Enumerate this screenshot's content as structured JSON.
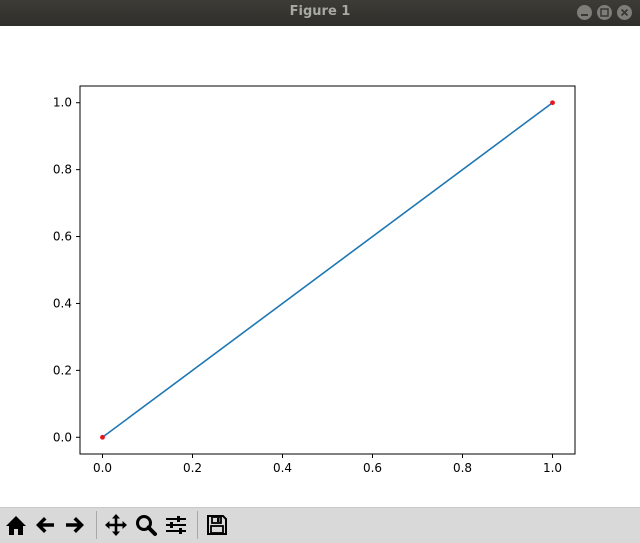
{
  "window": {
    "title": "Figure 1",
    "controls": [
      "minimize",
      "maximize",
      "close"
    ]
  },
  "chart_data": {
    "type": "line",
    "title": "",
    "xlabel": "",
    "ylabel": "",
    "xlim": [
      -0.05,
      1.05
    ],
    "ylim": [
      -0.05,
      1.05
    ],
    "x_ticks": [
      "0.0",
      "0.2",
      "0.4",
      "0.6",
      "0.8",
      "1.0"
    ],
    "y_ticks": [
      "0.0",
      "0.2",
      "0.4",
      "0.6",
      "0.8",
      "1.0"
    ],
    "grid": false,
    "series": [
      {
        "x": [
          0,
          1
        ],
        "y": [
          0,
          1
        ],
        "style": "line",
        "color": "#1f77b4"
      },
      {
        "x": [
          0,
          1
        ],
        "y": [
          0,
          1
        ],
        "style": "markers",
        "color": "#e8141c"
      }
    ]
  },
  "toolbar": {
    "buttons": [
      "home-icon",
      "back-icon",
      "forward-icon",
      "pan-icon",
      "zoom-icon",
      "configure-subplots-icon",
      "save-icon"
    ]
  }
}
